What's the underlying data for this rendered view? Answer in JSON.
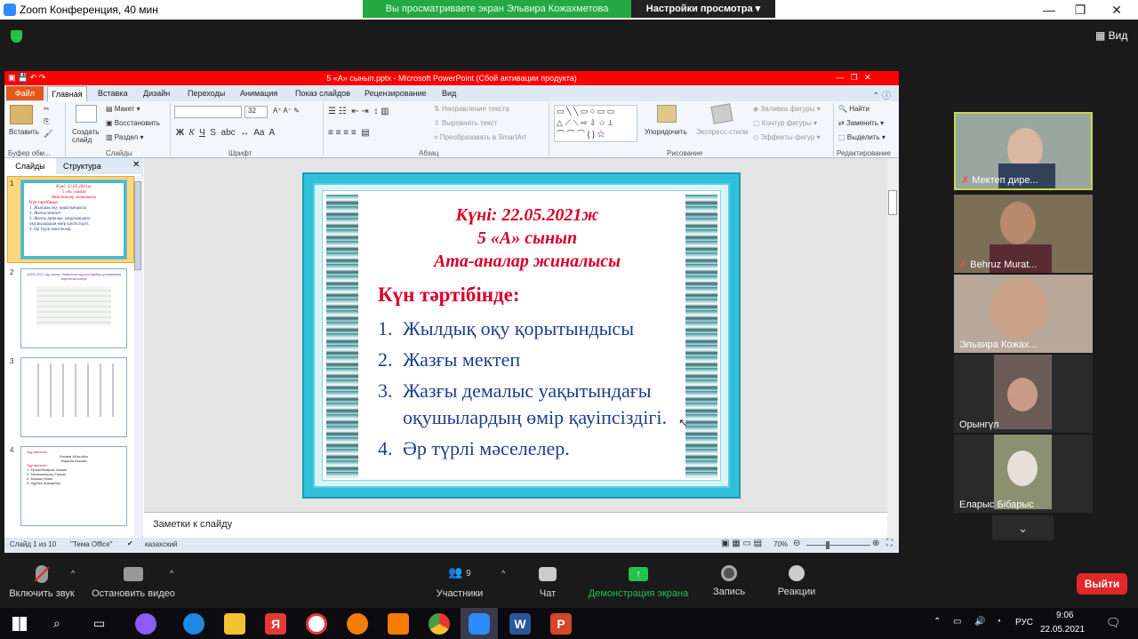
{
  "zoom": {
    "window_title": "Zoom Конференция, 40 мин",
    "share_banner": "Вы просматриваете экран Эльвира Кожахметова",
    "view_options": "Настройки просмотра ▾",
    "view_button": "Вид"
  },
  "ppt": {
    "title": "5 «А» сынып.pptx - Microsoft PowerPoint (Сбой активации продукта)",
    "tabs": [
      "Файл",
      "Главная",
      "Вставка",
      "Дизайн",
      "Переходы",
      "Анимация",
      "Показ слайдов",
      "Рецензирование",
      "Вид"
    ],
    "ribbon": {
      "paste": "Вставить",
      "new_slide": "Создать слайд",
      "layout": "Макет",
      "reset": "Восстановить",
      "section": "Раздел",
      "font_size": "32",
      "text_direction": "Направление текста",
      "align_text": "Выровнять текст",
      "convert_smartart": "Преобразовать в SmartArt",
      "arrange": "Упорядочить",
      "quick_styles": "Экспресс-стили",
      "shape_fill": "Заливка фигуры",
      "shape_outline": "Контур фигуры",
      "shape_effects": "Эффекты фигур",
      "find": "Найти",
      "replace": "Заменить",
      "select": "Выделить",
      "groups": {
        "clipboard": "Буфер обм...",
        "slides": "Слайды",
        "font": "Шрифт",
        "paragraph": "Абзац",
        "drawing": "Рисование",
        "editing": "Редактирование"
      }
    },
    "pane_tabs": {
      "slides": "Слайды",
      "outline": "Структура"
    },
    "thumbs": [
      {
        "num": "1",
        "lines": [
          "Күні: 22.05.2021ж",
          "5 «А» сынып",
          "Ата-аналар жиналысы",
          "Күн тәртібінде:",
          "1. Жылдық оқу қорытындысы",
          "2. Жазғы мектеп",
          "3. Жазғы демалыс уақытындағы оқушылардың өмір қауіпсіздігі.",
          "4. Әр түрлі мәселелер."
        ]
      },
      {
        "num": "2",
        "lines": [
          "2020-2021 оқу жылы бойынша оқушылардың үлгерімінің көрсеткіштері"
        ]
      },
      {
        "num": "3",
        "lines": []
      },
      {
        "num": "4",
        "lines": [
          "Оқу жетістігі:",
          "Бекиев Абзалбек",
          "Мадина Бекова",
          "Оқу жетістігі:",
          "1. Ержанбекқызы Аяжан",
          "2. Мекежанқызы Тоғжан",
          "3. Бекжан Маки",
          "4. Нұрбек Жанарбек"
        ]
      }
    ],
    "slide": {
      "date_line": "Күні: 22.05.2021ж",
      "class_line": "5 «А» сынып",
      "meeting_line": "Ата-аналар жиналысы",
      "agenda_title": "Күн тәртібінде:",
      "items": [
        {
          "num": "1.",
          "text": "Жылдық оқу қорытындысы"
        },
        {
          "num": "2.",
          "text": "Жазғы мектеп"
        },
        {
          "num": "3.",
          "text": "Жазғы демалыс уақытындағы"
        },
        {
          "num": "",
          "text": "оқушылардың өмір қауіпсіздігі."
        },
        {
          "num": "4.",
          "text": "Әр түрлі мәселелер."
        }
      ]
    },
    "notes_placeholder": "Заметки к слайду",
    "status": {
      "slide_of": "Слайд 1 из 10",
      "theme": "\"Тема Office\"",
      "language": "казахский",
      "zoom": "70%"
    }
  },
  "participants": [
    {
      "name": "Мектеп дире...",
      "muted": true,
      "bg": "#9aa7a0"
    },
    {
      "name": "Behruz Murat...",
      "muted": true,
      "bg": "#7c6f58"
    },
    {
      "name": "Эльвира Кожах...",
      "muted": false,
      "bg": "#b8a89a"
    },
    {
      "name": "Орынгүл",
      "muted": false,
      "bg": "#6b5b56"
    },
    {
      "name": "Еларыс Бібарыс",
      "muted": false,
      "bg": "#8b9070"
    }
  ],
  "toolbar": {
    "mute": "Включить звук",
    "video": "Остановить видео",
    "participants": "Участники",
    "participant_count": "9",
    "chat": "Чат",
    "share": "Демонстрация экрана",
    "record": "Запись",
    "reactions": "Реакции",
    "leave": "Выйти"
  },
  "tray": {
    "language": "РУС",
    "time": "9:06",
    "date": "22.05.2021"
  },
  "colors": {
    "share_green": "#23a842",
    "leave_red": "#e02828",
    "slide_red": "#d6002a",
    "slide_blue": "#1f3f8a"
  }
}
